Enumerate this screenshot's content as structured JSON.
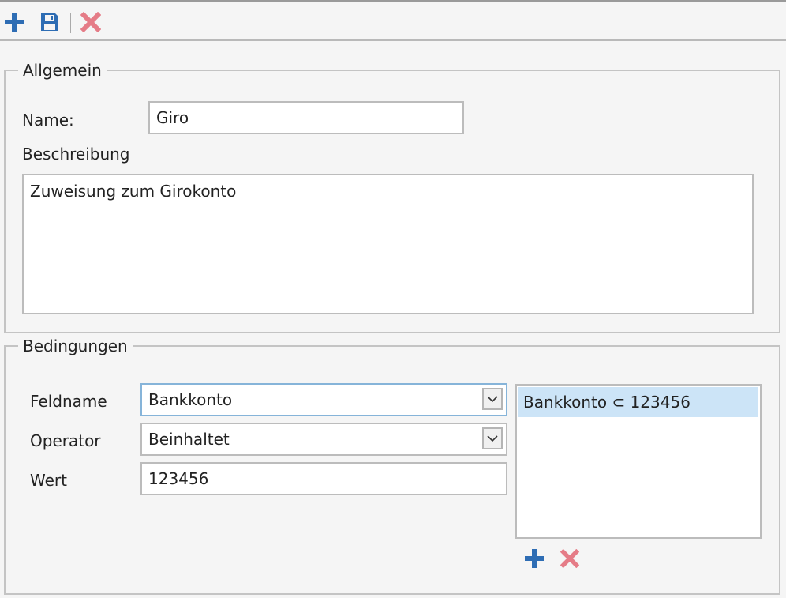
{
  "toolbar": {
    "add": {
      "icon": "plus-icon",
      "color": "#2e6db4"
    },
    "save": {
      "icon": "floppy-disk-icon",
      "color": "#2e6db4"
    },
    "delete": {
      "icon": "close-x-icon",
      "color": "#e57c87"
    }
  },
  "general": {
    "legend": "Allgemein",
    "name_label": "Name:",
    "name_value": "Giro",
    "description_label": "Beschreibung",
    "description_value": "Zuweisung zum Girokonto"
  },
  "conditions": {
    "legend": "Bedingungen",
    "field_label": "Feldname",
    "field_value": "Bankkonto",
    "operator_label": "Operator",
    "operator_value": "Beinhaltet",
    "value_label": "Wert",
    "value_value": "123456",
    "list": [
      "Bankkonto ⊂ 123456"
    ],
    "add": {
      "icon": "plus-icon",
      "color": "#2e6db4"
    },
    "delete": {
      "icon": "close-x-icon",
      "color": "#e57c87"
    }
  },
  "colors": {
    "accent": "#2e6db4",
    "delete": "#e57c87",
    "selection": "#cce4f7",
    "focus_border": "#86b4d9"
  }
}
